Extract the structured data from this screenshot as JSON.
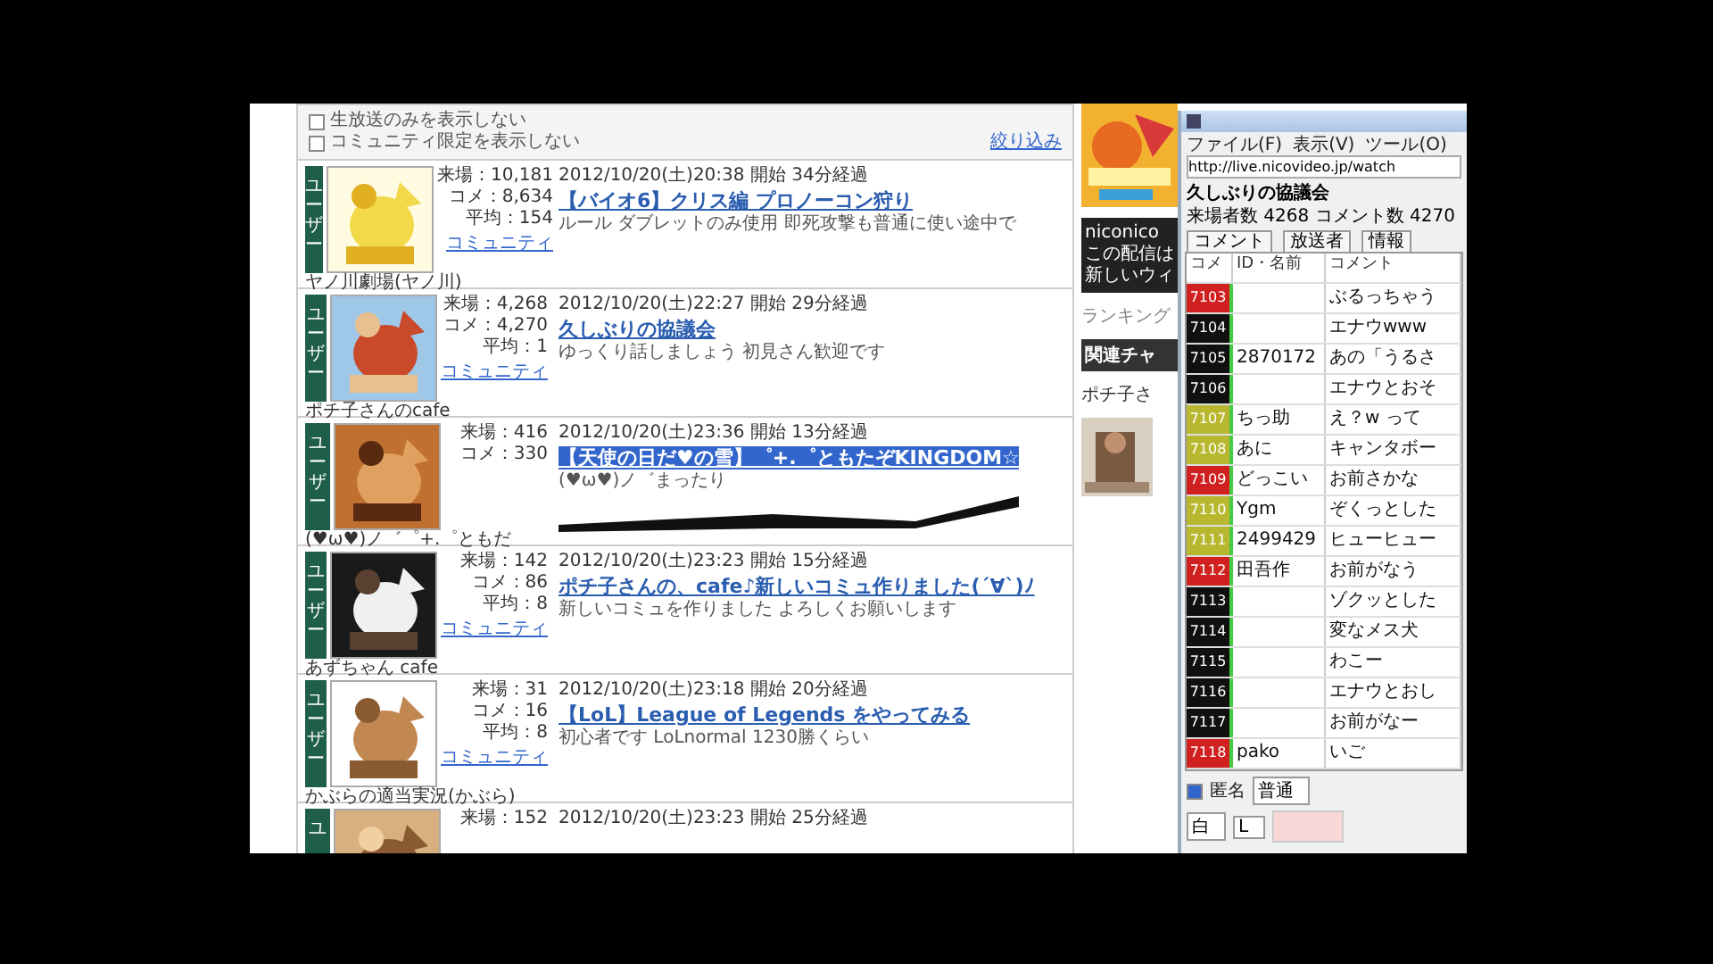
{
  "filter_bar": {
    "options": [
      {
        "label": "生放送のみを表示しない",
        "checked": false
      },
      {
        "label": "コミュニティ限定を表示しない",
        "checked": false
      }
    ],
    "link": "絞り込み"
  },
  "entries": [
    {
      "badge": "ユーザー",
      "stats": [
        "来場：10,181",
        "コメ：8,634",
        "平均：154"
      ],
      "community": "コミュニティ",
      "author": "ヤノ川劇場(ヤノ川)",
      "meta": "2012/10/20(土)20:38 開始 34分経過",
      "title": "【バイオ6】クリス編 プロノーコン狩り",
      "selected": false,
      "description": "ルール ダブレットのみ使用 即死攻撃も普通に使い途中で",
      "redacted": false
    },
    {
      "badge": "ユーザー",
      "stats": [
        "来場：4,268",
        "コメ：4,270",
        "平均：1"
      ],
      "community": "コミュニティ",
      "author": "ポチ子さんのcafe",
      "meta": "2012/10/20(土)22:27 開始 29分経過",
      "title": "久しぶりの協議会",
      "selected": false,
      "description": "ゆっくり話しましょう 初見さん歓迎です",
      "redacted": false
    },
    {
      "badge": "ユーザー",
      "stats": [
        "来場：416",
        "コメ：330"
      ],
      "author": "(♥ω♥)ノ゛゜+.゜ともだ",
      "meta": "2012/10/20(土)23:36 開始 13分経過",
      "title": "【天使の日だ♥の雪】゜+.゜ともたぞKINGDOM☆",
      "selected": true,
      "description": "(♥ω♥)ノ゛まったり",
      "redacted": true
    },
    {
      "badge": "ユーザー",
      "stats": [
        "来場：142",
        "コメ：86",
        "平均：8"
      ],
      "community": "コミュニティ",
      "author": "あずちゃん cafe",
      "meta": "2012/10/20(土)23:23 開始 15分経過",
      "title": "ポチ子さんの、cafe♪新しいコミュ作りました(´∀`)ﾉ",
      "selected": false,
      "description": "新しいコミュを作りました よろしくお願いします",
      "redacted": false
    },
    {
      "badge": "ユーザー",
      "stats": [
        "来場：31",
        "コメ：16",
        "平均：8"
      ],
      "community": "コミュニティ",
      "author": "かぶらの適当実況(かぶら)",
      "meta": "2012/10/20(土)23:18 開始 20分経過",
      "title": "【LoL】League of Legends をやってみる",
      "selected": false,
      "description": "初心者です LoLnormal 1230勝くらい",
      "redacted": false
    },
    {
      "badge": "ユ",
      "stats": [
        "来場：152"
      ],
      "meta": "2012/10/20(土)23:23 開始 25分経過"
    }
  ],
  "side_column": {
    "notice": [
      "niconico",
      "この配信は",
      "新しいウィ"
    ],
    "ranking": "ランキング",
    "heading": "関連チャ",
    "related": "ポチ子さ"
  },
  "chat_window": {
    "menu": [
      "ファイル(F)",
      "表示(V)",
      "ツール(O)"
    ],
    "url": "http://live.nicovideo.jp/watch",
    "title": "久しぶりの協議会",
    "info": "来場者数 4268 コメント数 4270",
    "tabs": [
      "コメント",
      "放送者",
      "情報"
    ],
    "header": [
      "コメ",
      "ID・名前",
      "コメント"
    ],
    "rows": [
      {
        "no": "7103",
        "color": "#d02020",
        "user": "",
        "comment": "ぶるっちゃう"
      },
      {
        "no": "7104",
        "color": "#101010",
        "user": "",
        "comment": "エナウwww"
      },
      {
        "no": "7105",
        "color": "#101010",
        "user": "2870172",
        "comment": "あの「うるさ"
      },
      {
        "no": "7106",
        "color": "#101010",
        "user": "",
        "comment": "エナウとおそ"
      },
      {
        "no": "7107",
        "color": "#b8b830",
        "user": "ちっ助",
        "comment": "え？w って"
      },
      {
        "no": "7108",
        "color": "#b8b830",
        "user": "あに",
        "comment": "キャンタボー"
      },
      {
        "no": "7109",
        "color": "#d02020",
        "user": "どっこい",
        "comment": "お前さかな"
      },
      {
        "no": "7110",
        "color": "#b8b830",
        "user": "Ygm",
        "comment": "ぞくっとした"
      },
      {
        "no": "7111",
        "color": "#b8b830",
        "user": "2499429",
        "comment": "ヒューヒュー"
      },
      {
        "no": "7112",
        "color": "#d02020",
        "user": "田吾作",
        "comment": "お前がなう"
      },
      {
        "no": "7113",
        "color": "#101010",
        "user": "",
        "comment": "ゾクッとした"
      },
      {
        "no": "7114",
        "color": "#101010",
        "user": "",
        "comment": "変なメス犬"
      },
      {
        "no": "7115",
        "color": "#101010",
        "user": "",
        "comment": "わこー"
      },
      {
        "no": "7116",
        "color": "#101010",
        "user": "",
        "comment": "エナウとおし"
      },
      {
        "no": "7117",
        "color": "#101010",
        "user": "",
        "comment": "お前がなー"
      },
      {
        "no": "7118",
        "color": "#d02020",
        "user": "pako",
        "comment": "いご"
      }
    ],
    "anonymous": {
      "label": "匿名",
      "checked": true
    },
    "size_select": "普通",
    "color_select": "白",
    "position_select": "L"
  }
}
